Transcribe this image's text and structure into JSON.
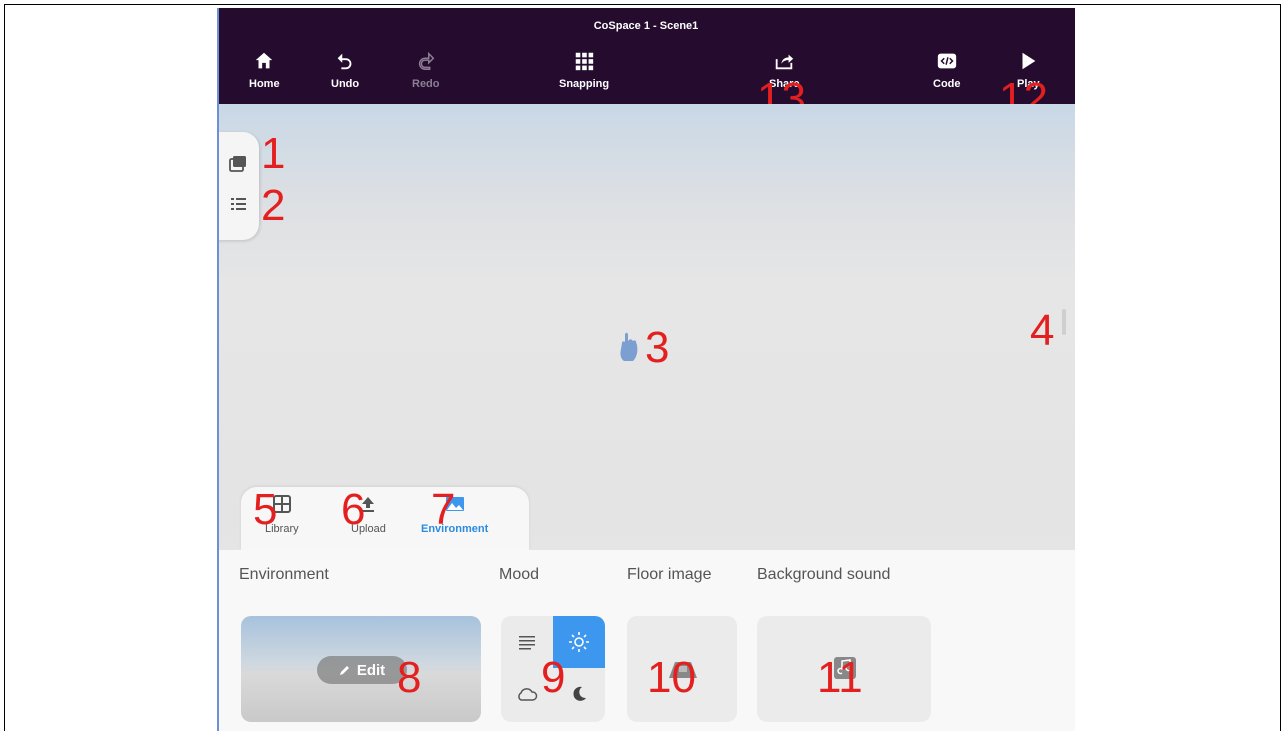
{
  "window": {
    "title": "CoSpace 1 - Scene1"
  },
  "toolbar": {
    "home": "Home",
    "undo": "Undo",
    "redo": "Redo",
    "snapping": "Snapping",
    "share": "Share",
    "code": "Code",
    "play": "Play"
  },
  "bottom_tabs": {
    "library": "Library",
    "upload": "Upload",
    "environment": "Environment",
    "active": "Environment"
  },
  "panel": {
    "environment_label": "Environment",
    "mood_label": "Mood",
    "floor_label": "Floor image",
    "sound_label": "Background sound",
    "edit_label": "Edit",
    "mood_selected": "sun"
  },
  "annotations": {
    "n1": "1",
    "n2": "2",
    "n3": "3",
    "n4": "4",
    "n5": "5",
    "n6": "6",
    "n7": "7",
    "n8": "8",
    "n9": "9",
    "n10": "10",
    "n11": "11",
    "n12": "12",
    "n13": "13"
  },
  "colors": {
    "topbar": "#250b2e",
    "accent": "#3d97ef",
    "annotation": "#e41f1f"
  },
  "icons": [
    "home-icon",
    "undo-icon",
    "redo-icon",
    "grid-icon",
    "share-icon",
    "code-icon",
    "play-icon",
    "gallery-icon",
    "list-icon",
    "hand-icon",
    "library-icon",
    "upload-icon",
    "environment-icon",
    "pencil-icon",
    "lines-icon",
    "sun-icon",
    "cloud-icon",
    "moon-icon",
    "floor-image-icon",
    "music-icon"
  ]
}
